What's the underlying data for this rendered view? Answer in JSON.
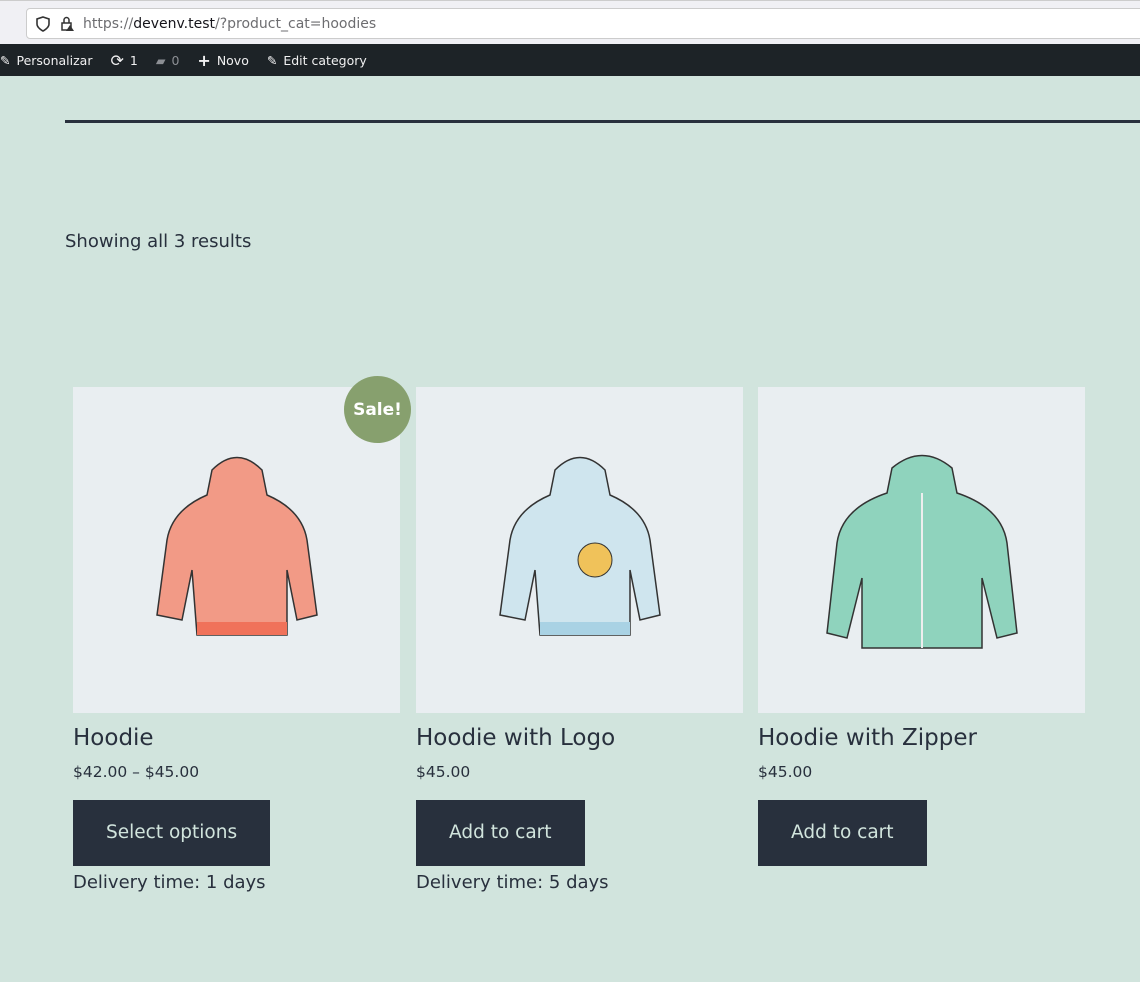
{
  "browser": {
    "url_scheme": "https://",
    "url_host": "devenv.test",
    "url_path": "/?product_cat=hoodies"
  },
  "admin_bar": {
    "customize": "Personalizar",
    "updates": "1",
    "comments": "0",
    "new": "Novo",
    "edit": "Edit category"
  },
  "result_count": "Showing all 3 results",
  "colors": {
    "background": "#d1e4dd",
    "button": "#28303d",
    "sale": "#87a06e"
  },
  "products": [
    {
      "title": "Hoodie",
      "price": "$42.00 – $45.00",
      "button": "Select options",
      "delivery": "Delivery time: 1 days",
      "badge": "Sale!",
      "color": "#f29a86"
    },
    {
      "title": "Hoodie with Logo",
      "price": "$45.00",
      "button": "Add to cart",
      "delivery": "Delivery time: 5 days",
      "color": "#cfe5ee"
    },
    {
      "title": "Hoodie with Zipper",
      "price": "$45.00",
      "button": "Add to cart",
      "color": "#8fd3bd"
    }
  ]
}
